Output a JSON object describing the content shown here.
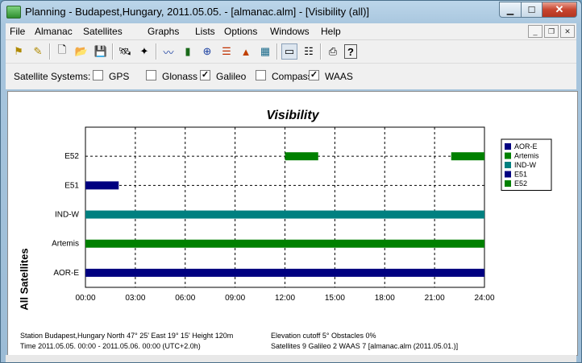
{
  "window": {
    "title": "Planning - Budapest,Hungary, 2011.05.05. - [almanac.alm] - [Visibility (all)]",
    "minimize_glyph": "▁",
    "maximize_glyph": "☐",
    "close_glyph": "✕",
    "mdi_minimize_glyph": "_",
    "mdi_restore_glyph": "❐",
    "mdi_close_glyph": "✕"
  },
  "menu": [
    "File",
    "Almanac",
    "Satellites",
    "Graphs",
    "Lists",
    "Options",
    "Windows",
    "Help"
  ],
  "toolbar": {
    "icons": [
      {
        "name": "station-icon",
        "glyph": "⚑"
      },
      {
        "name": "station-edit-icon",
        "glyph": "✎"
      },
      {
        "name": "new-file-icon",
        "glyph": "🗋"
      },
      {
        "name": "open-folder-icon",
        "glyph": "📂"
      },
      {
        "name": "save-icon",
        "glyph": "💾"
      },
      {
        "name": "satellite-icon",
        "glyph": "🛰"
      },
      {
        "name": "satellite-select-icon",
        "glyph": "✦"
      },
      {
        "name": "elevation-graph-icon",
        "glyph": "〰"
      },
      {
        "name": "bar-graph-icon",
        "glyph": "▮"
      },
      {
        "name": "skyplot-icon",
        "glyph": "⊕"
      },
      {
        "name": "visibility-graph-icon",
        "glyph": "☰"
      },
      {
        "name": "dop-graph-icon",
        "glyph": "▲"
      },
      {
        "name": "world-map-icon",
        "glyph": "▦"
      },
      {
        "name": "graph-view-icon",
        "glyph": "▭"
      },
      {
        "name": "list-view-icon",
        "glyph": "☷"
      },
      {
        "name": "print-icon",
        "glyph": "⎙"
      },
      {
        "name": "help-icon",
        "glyph": "?"
      }
    ]
  },
  "satellite_systems": {
    "label": "Satellite Systems:",
    "checked_glyph": "✓",
    "options": [
      {
        "label": "GPS",
        "checked": false
      },
      {
        "label": "Glonass",
        "checked": false
      },
      {
        "label": "Galileo",
        "checked": true
      },
      {
        "label": "Compass",
        "checked": false
      },
      {
        "label": "WAAS",
        "checked": true
      }
    ]
  },
  "colors": {
    "navy": "#000080",
    "green": "#008000",
    "teal": "#008080"
  },
  "chart_data": {
    "type": "bar",
    "title": "Visibility",
    "ylabel": "All Satellites",
    "x_ticks": [
      "00:00",
      "03:00",
      "06:00",
      "09:00",
      "12:00",
      "15:00",
      "18:00",
      "21:00",
      "24:00"
    ],
    "x_range_hours": [
      0,
      24
    ],
    "categories": [
      "AOR-E",
      "Artemis",
      "IND-W",
      "E51",
      "E52"
    ],
    "series": [
      {
        "name": "AOR-E",
        "color": "#000080",
        "intervals": [
          [
            0,
            24
          ]
        ]
      },
      {
        "name": "Artemis",
        "color": "#008000",
        "intervals": [
          [
            0,
            24
          ]
        ]
      },
      {
        "name": "IND-W",
        "color": "#008080",
        "intervals": [
          [
            0,
            24
          ]
        ]
      },
      {
        "name": "E51",
        "color": "#000080",
        "intervals": [
          [
            0,
            2
          ]
        ]
      },
      {
        "name": "E52",
        "color": "#008000",
        "intervals": [
          [
            12,
            14
          ],
          [
            22,
            24
          ]
        ]
      }
    ],
    "grid": true,
    "legend_position": "top-right"
  },
  "footer": {
    "station": "Station Budapest,Hungary   North 47° 25'   East 19° 15'   Height 120m",
    "time": "Time 2011.05.05.  00:00  -  2011.05.06.  00:00 (UTC+2.0h)",
    "elevation": "Elevation cutoff 5°   Obstacles 0%",
    "satellites": "Satellites 9   Galileo 2   WAAS 7   [almanac.alm (2011.05.01.)]"
  }
}
